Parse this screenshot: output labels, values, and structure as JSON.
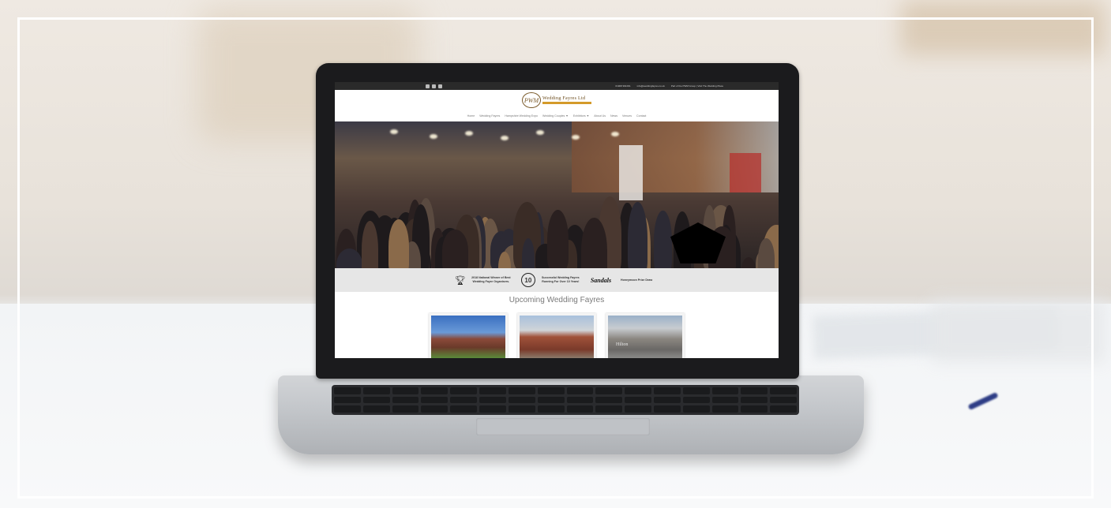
{
  "site": {
    "top_bar": {
      "phone": "01908 991091",
      "email": "info@weddingfayres.co.uk",
      "tagline": "Part of the PWM Group | Visit The Wedding Place",
      "social_icons": [
        "facebook-icon",
        "twitter-icon",
        "instagram-icon"
      ]
    },
    "logo": {
      "monogram": "PWM",
      "name": "Wedding Fayres Ltd"
    },
    "nav": {
      "items": [
        "Home",
        "Wedding Fayres",
        "Hampshire Wedding Expo",
        "Wedding Couples ▼",
        "Exhibitors ▼",
        "About Us",
        "News",
        "Venues",
        "Contact"
      ]
    },
    "awards": {
      "winner_text": "2018 National Winner of Best Wedding Fayre Organisers.",
      "years_badge": "10",
      "years_text": "Successful Wedding Fayres Running For Over 10 Years!",
      "sponsor": "Sandals",
      "sponsor_text": "Honeymoon Prize Draw"
    },
    "upcoming": {
      "title": "Upcoming Wedding Fayres",
      "venue_3_sign": "Hilton"
    }
  },
  "colors": {
    "top_bar": "#2a2a2a",
    "logo_gold": "#d49a2a",
    "awards_bg": "#e6e6e6",
    "section_title": "#7a7a7a"
  }
}
